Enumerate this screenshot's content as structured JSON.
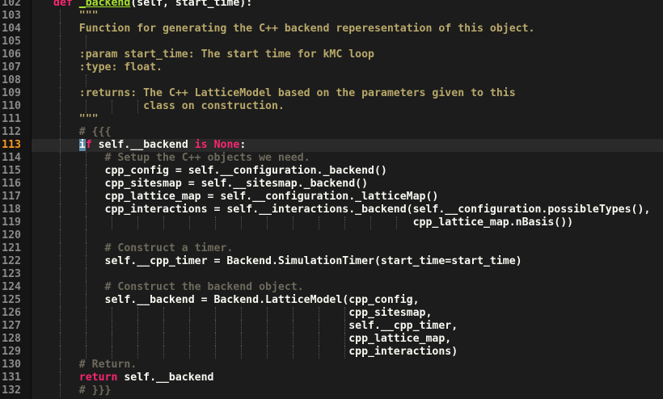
{
  "colors": {
    "background": "#1c1c1c",
    "gutter": "#151515",
    "line_number": "#8a8a8a",
    "active_line_number": "#fd971f",
    "keyword": "#f92672",
    "function_name": "#a6e22e",
    "docstring": "#b8a86a",
    "comment": "#6d6a5c",
    "text": "#f8f8f2",
    "cursor": "#5c8aa8"
  },
  "editor": {
    "active_line": "113",
    "lines": [
      {
        "num": "102",
        "tokens": [
          {
            "t": "def",
            "c": "kw"
          },
          {
            "t": " ",
            "c": ""
          },
          {
            "t": "_backend",
            "c": "fn"
          },
          {
            "t": "(self, start_time):",
            "c": ""
          }
        ]
      },
      {
        "num": "103",
        "tokens": [
          {
            "t": "    \"\"\"",
            "c": "doc"
          }
        ]
      },
      {
        "num": "104",
        "tokens": [
          {
            "t": "    Function for generating the C++ backend reperesentation of this object.",
            "c": "doc"
          }
        ]
      },
      {
        "num": "105",
        "tokens": []
      },
      {
        "num": "106",
        "tokens": [
          {
            "t": "    :param start_time: The start time for kMC loop",
            "c": "doc"
          }
        ]
      },
      {
        "num": "107",
        "tokens": [
          {
            "t": "    :type: float.",
            "c": "doc"
          }
        ]
      },
      {
        "num": "108",
        "tokens": []
      },
      {
        "num": "109",
        "tokens": [
          {
            "t": "    :returns: The C++ LatticeModel based on the parameters given to this",
            "c": "doc"
          }
        ]
      },
      {
        "num": "110",
        "tokens": [
          {
            "t": "              class on construction.",
            "c": "doc"
          }
        ]
      },
      {
        "num": "111",
        "tokens": [
          {
            "t": "    \"\"\"",
            "c": "doc"
          }
        ]
      },
      {
        "num": "112",
        "tokens": [
          {
            "t": "    # {{{",
            "c": "cmt"
          }
        ]
      },
      {
        "num": "113",
        "tokens": [
          {
            "t": "    ",
            "c": ""
          },
          {
            "t": "i",
            "c": "cur"
          },
          {
            "t": "f",
            "c": "kw"
          },
          {
            "t": " self.__backend ",
            "c": ""
          },
          {
            "t": "is",
            "c": "kw"
          },
          {
            "t": " ",
            "c": ""
          },
          {
            "t": "None",
            "c": "kw"
          },
          {
            "t": ":",
            "c": ""
          }
        ]
      },
      {
        "num": "114",
        "tokens": [
          {
            "t": "        # Setup the C++ objects we need.",
            "c": "cmt"
          }
        ]
      },
      {
        "num": "115",
        "tokens": [
          {
            "t": "        cpp_config = self.__configuration._backend()",
            "c": ""
          }
        ]
      },
      {
        "num": "116",
        "tokens": [
          {
            "t": "        cpp_sitesmap = self.__sitesmap._backend()",
            "c": ""
          }
        ]
      },
      {
        "num": "117",
        "tokens": [
          {
            "t": "        cpp_lattice_map = self.__configuration._latticeMap()",
            "c": ""
          }
        ]
      },
      {
        "num": "118",
        "tokens": [
          {
            "t": "        cpp_interactions = self.__interactions._backend(self.__configuration.possibleTypes(),",
            "c": ""
          }
        ]
      },
      {
        "num": "119",
        "tokens": [
          {
            "t": "                                                        cpp_lattice_map.nBasis())",
            "c": ""
          }
        ]
      },
      {
        "num": "120",
        "tokens": []
      },
      {
        "num": "121",
        "tokens": [
          {
            "t": "        # Construct a timer.",
            "c": "cmt"
          }
        ]
      },
      {
        "num": "122",
        "tokens": [
          {
            "t": "        self.__cpp_timer = Backend.SimulationTimer(start_time=start_time)",
            "c": ""
          }
        ]
      },
      {
        "num": "123",
        "tokens": []
      },
      {
        "num": "124",
        "tokens": [
          {
            "t": "        # Construct the backend object.",
            "c": "cmt"
          }
        ]
      },
      {
        "num": "125",
        "tokens": [
          {
            "t": "        self.__backend = Backend.LatticeModel(cpp_config,",
            "c": ""
          }
        ]
      },
      {
        "num": "126",
        "tokens": [
          {
            "t": "                                              cpp_sitesmap,",
            "c": ""
          }
        ]
      },
      {
        "num": "127",
        "tokens": [
          {
            "t": "                                              self.__cpp_timer,",
            "c": ""
          }
        ]
      },
      {
        "num": "128",
        "tokens": [
          {
            "t": "                                              cpp_lattice_map,",
            "c": ""
          }
        ]
      },
      {
        "num": "129",
        "tokens": [
          {
            "t": "                                              cpp_interactions)",
            "c": ""
          }
        ]
      },
      {
        "num": "130",
        "tokens": [
          {
            "t": "    # Return.",
            "c": "cmt"
          }
        ]
      },
      {
        "num": "131",
        "tokens": [
          {
            "t": "    ",
            "c": ""
          },
          {
            "t": "return",
            "c": "kw"
          },
          {
            "t": " self.__backend",
            "c": ""
          }
        ]
      },
      {
        "num": "132",
        "tokens": [
          {
            "t": "    # }}}",
            "c": "cmt"
          }
        ]
      }
    ]
  }
}
